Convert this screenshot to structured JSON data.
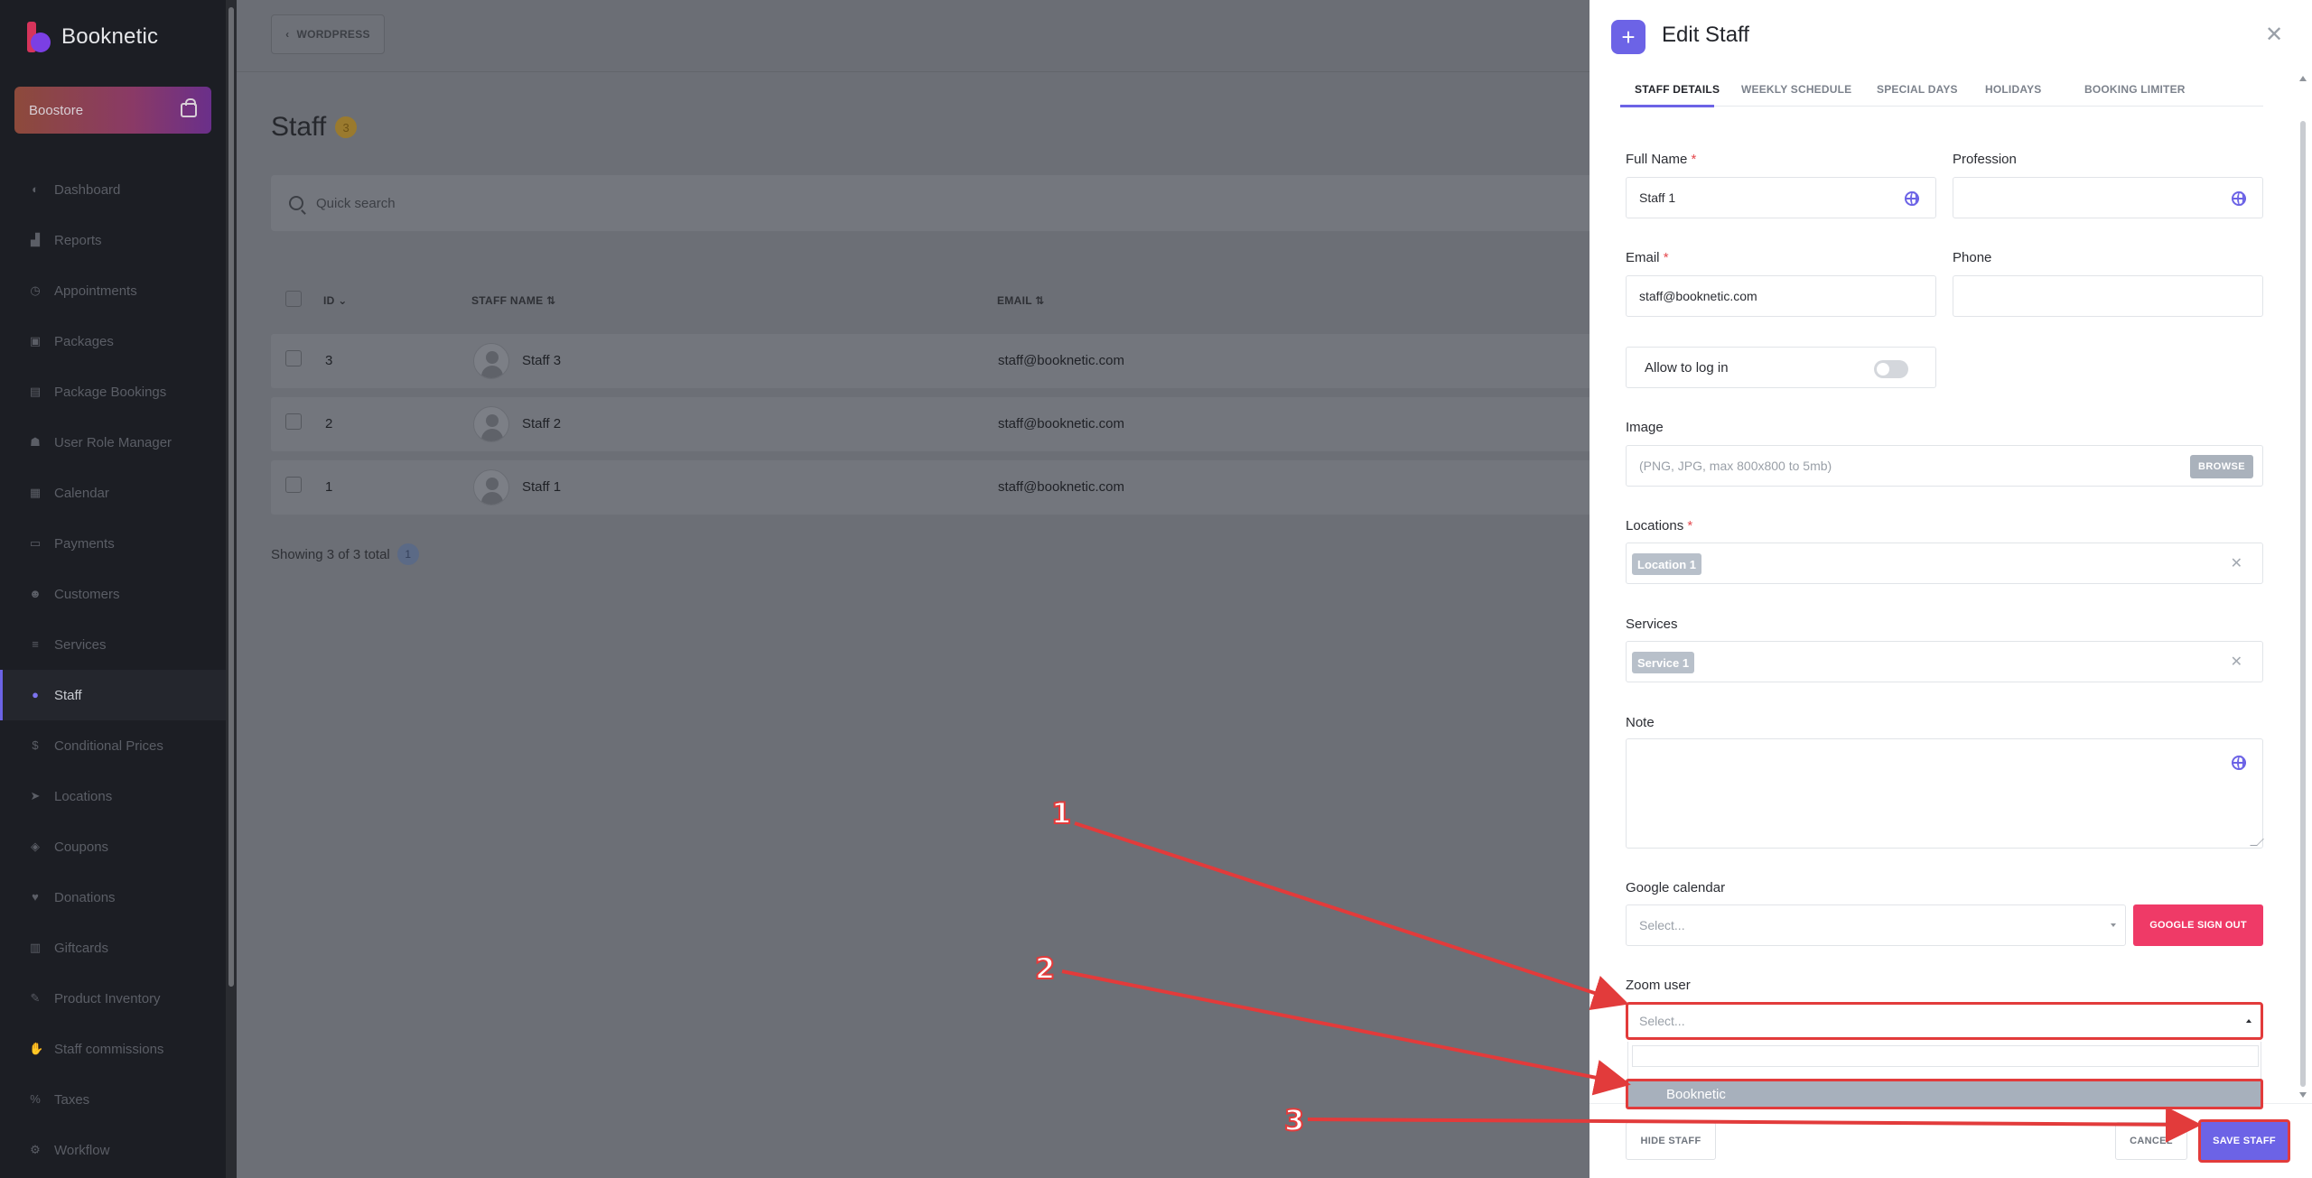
{
  "sidebar": {
    "brand": "Booknetic",
    "boostore_label": "Boostore",
    "items": [
      {
        "label": "Dashboard",
        "icon": "dashboard-icon",
        "glyph": "◐"
      },
      {
        "label": "Reports",
        "icon": "reports-icon",
        "glyph": "▟"
      },
      {
        "label": "Appointments",
        "icon": "clock-icon",
        "glyph": "◷"
      },
      {
        "label": "Packages",
        "icon": "package-icon",
        "glyph": "▣"
      },
      {
        "label": "Package Bookings",
        "icon": "briefcase-icon",
        "glyph": "▤"
      },
      {
        "label": "User Role Manager",
        "icon": "user-role-icon",
        "glyph": "☗"
      },
      {
        "label": "Calendar",
        "icon": "calendar-icon",
        "glyph": "▦"
      },
      {
        "label": "Payments",
        "icon": "payments-icon",
        "glyph": "▭"
      },
      {
        "label": "Customers",
        "icon": "customers-icon",
        "glyph": "☻"
      },
      {
        "label": "Services",
        "icon": "services-icon",
        "glyph": "≡"
      },
      {
        "label": "Staff",
        "icon": "staff-icon",
        "glyph": "●",
        "active": true
      },
      {
        "label": "Conditional Prices",
        "icon": "dollar-icon",
        "glyph": "$"
      },
      {
        "label": "Locations",
        "icon": "location-arrow-icon",
        "glyph": "➤"
      },
      {
        "label": "Coupons",
        "icon": "tag-icon",
        "glyph": "◈"
      },
      {
        "label": "Donations",
        "icon": "donation-icon",
        "glyph": "♥"
      },
      {
        "label": "Giftcards",
        "icon": "giftcard-icon",
        "glyph": "▥"
      },
      {
        "label": "Product Inventory",
        "icon": "tools-icon",
        "glyph": "✎"
      },
      {
        "label": "Staff commissions",
        "icon": "handshake-icon",
        "glyph": "✋"
      },
      {
        "label": "Taxes",
        "icon": "percent-icon",
        "glyph": "%"
      },
      {
        "label": "Workflow",
        "icon": "workflow-icon",
        "glyph": "⚙"
      }
    ]
  },
  "topbar": {
    "back_label": "WORDPRESS"
  },
  "main": {
    "title": "Staff",
    "count": "3",
    "search_placeholder": "Quick search",
    "columns": {
      "id": "ID",
      "name": "STAFF NAME",
      "email": "EMAIL"
    },
    "rows": [
      {
        "id": "3",
        "name": "Staff 3",
        "email": "staff@booknetic.com"
      },
      {
        "id": "2",
        "name": "Staff 2",
        "email": "staff@booknetic.com"
      },
      {
        "id": "1",
        "name": "Staff 1",
        "email": "staff@booknetic.com"
      }
    ],
    "showing": "Showing 3 of 3 total",
    "page": "1"
  },
  "panel": {
    "title": "Edit Staff",
    "tabs": [
      "STAFF DETAILS",
      "WEEKLY SCHEDULE",
      "SPECIAL DAYS",
      "HOLIDAYS",
      "BOOKING LIMITER"
    ],
    "full_name_label": "Full Name",
    "full_name_value": "Staff 1",
    "profession_label": "Profession",
    "profession_value": "",
    "email_label": "Email",
    "email_value": "staff@booknetic.com",
    "phone_label": "Phone",
    "phone_value": "",
    "allow_login_label": "Allow to log in",
    "allow_login_on": false,
    "image_label": "Image",
    "image_placeholder": "(PNG, JPG, max 800x800 to 5mb)",
    "browse_label": "BROWSE",
    "locations_label": "Locations",
    "location_tag": "Location 1",
    "services_label": "Services",
    "service_tag": "Service 1",
    "note_label": "Note",
    "google_label": "Google calendar",
    "google_placeholder": "Select...",
    "google_signout": "GOOGLE SIGN OUT",
    "zoom_label": "Zoom user",
    "zoom_placeholder": "Select...",
    "zoom_option": "Booknetic",
    "hide_label": "HIDE STAFF",
    "cancel_label": "CANCEL",
    "save_label": "SAVE STAFF",
    "required_mark": "*"
  },
  "annotations": {
    "step1": "1",
    "step2": "2",
    "step3": "3",
    "color": "#e23b3b"
  }
}
